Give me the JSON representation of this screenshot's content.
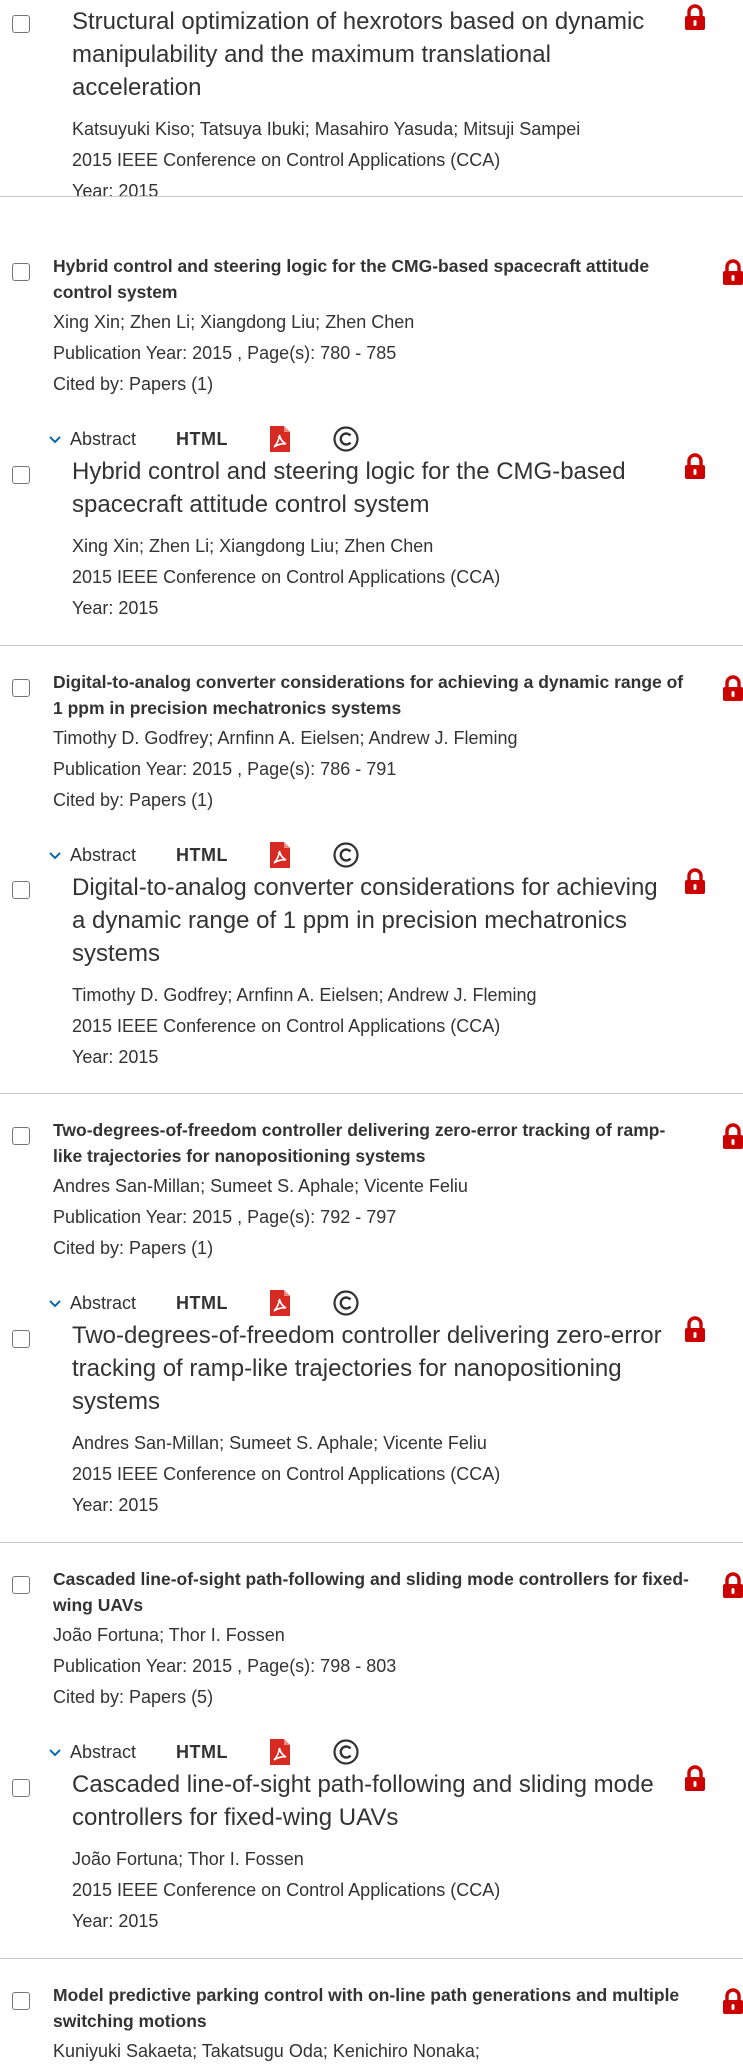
{
  "lead": {
    "title": "Structural optimization of hexrotors based on dynamic manipulability and the maximum translational acceleration",
    "authors": "Katsuyuki Kiso; Tatsuya Ibuki; Masahiro Yasuda; Mitsuji Sampei",
    "conference": "2015 IEEE Conference on Control Applications (CCA)",
    "year": "Year: 2015"
  },
  "actions": {
    "abstract_label": "Abstract",
    "html_label": "HTML"
  },
  "articles": [
    {
      "title": "Hybrid control and steering logic for the CMG-based spacecraft attitude control system",
      "authors": "Xing Xin; Zhen Li; Xiangdong Liu; Zhen Chen",
      "pub": "Publication Year: 2015 , Page(s): 780 - 785",
      "cited": "Cited by: Papers (1)",
      "detail_title": "Hybrid control and steering logic for the CMG-based spacecraft attitude control system",
      "detail_authors": "Xing Xin; Zhen Li; Xiangdong Liu; Zhen Chen",
      "detail_conference": "2015 IEEE Conference on Control Applications (CCA)",
      "detail_year": "Year: 2015"
    },
    {
      "title": "Digital-to-analog converter considerations for achieving a dynamic range of 1 ppm in precision mechatronics systems",
      "authors": "Timothy D. Godfrey; Arnfinn A. Eielsen; Andrew J. Fleming",
      "pub": "Publication Year: 2015 , Page(s): 786 - 791",
      "cited": "Cited by: Papers (1)",
      "detail_title": "Digital-to-analog converter considerations for achieving a dynamic range of 1 ppm in precision mechatronics systems",
      "detail_authors": "Timothy D. Godfrey; Arnfinn A. Eielsen; Andrew J. Fleming",
      "detail_conference": "2015 IEEE Conference on Control Applications (CCA)",
      "detail_year": "Year: 2015"
    },
    {
      "title": "Two-degrees-of-freedom controller delivering zero-error tracking of ramp-like trajectories for nanopositioning systems",
      "authors": "Andres San-Millan; Sumeet S. Aphale; Vicente Feliu",
      "pub": "Publication Year: 2015 , Page(s): 792 - 797",
      "cited": "Cited by: Papers (1)",
      "detail_title": "Two-degrees-of-freedom controller delivering zero-error tracking of ramp-like trajectories for nanopositioning systems",
      "detail_authors": "Andres San-Millan; Sumeet S. Aphale; Vicente Feliu",
      "detail_conference": "2015 IEEE Conference on Control Applications (CCA)",
      "detail_year": "Year: 2015"
    },
    {
      "title": "Cascaded line-of-sight path-following and sliding mode controllers for fixed-wing UAVs",
      "authors": "João Fortuna; Thor I. Fossen",
      "pub": "Publication Year: 2015 , Page(s): 798 - 803",
      "cited": "Cited by: Papers (5)",
      "detail_title": "Cascaded line-of-sight path-following and sliding mode controllers for fixed-wing UAVs",
      "detail_authors": "João Fortuna; Thor I. Fossen",
      "detail_conference": "2015 IEEE Conference on Control Applications (CCA)",
      "detail_year": "Year: 2015"
    },
    {
      "title": "Model predictive parking control with on-line path generations and multiple switching motions",
      "authors": "Kuniyuki Sakaeta; Takatsugu Oda; Kenichiro Nonaka;"
    }
  ],
  "colors": {
    "lock_red": "#cc0000",
    "pdf_red": "#d62a22",
    "separator": "#c9c9c9",
    "text": "#333333"
  },
  "icons": [
    "lock-icon",
    "pdf-icon",
    "copyright-icon",
    "chevron-down-icon",
    "checkbox"
  ]
}
